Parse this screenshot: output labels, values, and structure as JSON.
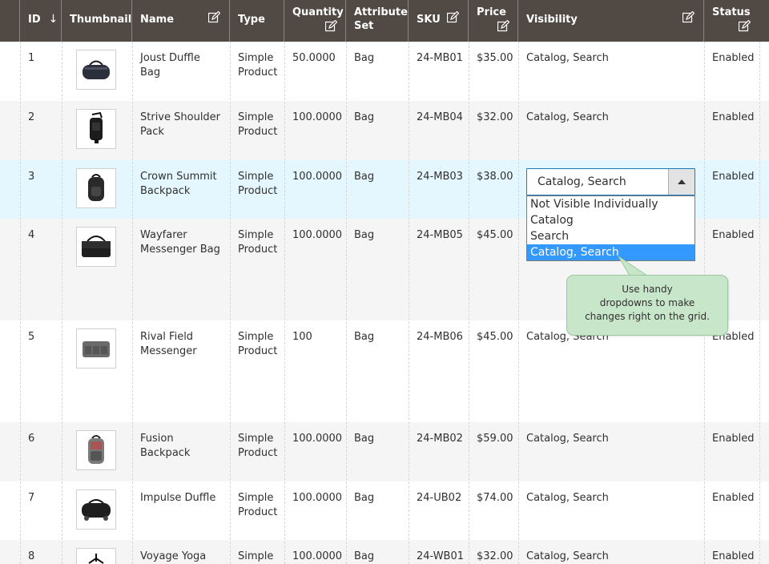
{
  "columns": [
    {
      "label": "ID",
      "sort_icon": "↓"
    },
    {
      "label": "Thumbnail"
    },
    {
      "label": "Name"
    },
    {
      "label": "Type"
    },
    {
      "label": "Quantity"
    },
    {
      "label": "Attribute Set"
    },
    {
      "label": "SKU"
    },
    {
      "label": "Price"
    },
    {
      "label": "Visibility"
    },
    {
      "label": "Status"
    }
  ],
  "rows": [
    {
      "id": "1",
      "name": "Joust Duffle Bag",
      "type": "Simple Product",
      "quantity": "50.0000",
      "attribute_set": "Bag",
      "sku": "24-MB01",
      "price": "$35.00",
      "visibility": "Catalog, Search",
      "status": "Enabled",
      "thumb_icon": "duffle-bag-icon"
    },
    {
      "id": "2",
      "name": "Strive Shoulder Pack",
      "type": "Simple Product",
      "quantity": "100.0000",
      "attribute_set": "Bag",
      "sku": "24-MB04",
      "price": "$32.00",
      "visibility": "Catalog, Search",
      "status": "Enabled",
      "thumb_icon": "shoulder-pack-icon"
    },
    {
      "id": "3",
      "name": "Crown Summit Backpack",
      "type": "Simple Product",
      "quantity": "100.0000",
      "attribute_set": "Bag",
      "sku": "24-MB03",
      "price": "$38.00",
      "visibility": "Catalog, Search",
      "status": "Enabled",
      "thumb_icon": "backpack-icon"
    },
    {
      "id": "4",
      "name": "Wayfarer Messenger Bag",
      "type": "Simple Product",
      "quantity": "100.0000",
      "attribute_set": "Bag",
      "sku": "24-MB05",
      "price": "$45.00",
      "visibility": "",
      "status": "Enabled",
      "thumb_icon": "messenger-bag-icon"
    },
    {
      "id": "5",
      "name": "Rival Field Messenger",
      "type": "Simple Product",
      "quantity": "100",
      "attribute_set": "Bag",
      "sku": "24-MB06",
      "price": "$45.00",
      "visibility": "Catalog, Search",
      "status": "Enabled",
      "thumb_icon": "field-messenger-icon"
    },
    {
      "id": "6",
      "name": "Fusion Backpack",
      "type": "Simple Product",
      "quantity": "100.0000",
      "attribute_set": "Bag",
      "sku": "24-MB02",
      "price": "$59.00",
      "visibility": "Catalog, Search",
      "status": "Enabled",
      "thumb_icon": "fusion-backpack-icon"
    },
    {
      "id": "7",
      "name": "Impulse Duffle",
      "type": "Simple Product",
      "quantity": "100.0000",
      "attribute_set": "Bag",
      "sku": "24-UB02",
      "price": "$74.00",
      "visibility": "Catalog, Search",
      "status": "Enabled",
      "thumb_icon": "rolling-duffle-icon"
    },
    {
      "id": "8",
      "name": "Voyage Yoga",
      "type": "Simple",
      "quantity": "100.0000",
      "attribute_set": "Bag",
      "sku": "24-WB01",
      "price": "$32.00",
      "visibility": "Catalog, Search",
      "status": "Enabled",
      "thumb_icon": "yoga-bag-icon"
    }
  ],
  "visibility_dropdown": {
    "selected": "Catalog, Search",
    "options": [
      "Not Visible Individually",
      "Catalog",
      "Search",
      "Catalog, Search"
    ],
    "highlighted_index": 3
  },
  "tooltip": {
    "lines": [
      "Use handy",
      "dropdowns to make",
      "changes right on the grid."
    ]
  },
  "colors": {
    "header_bg": "#514943",
    "active_row_bg": "#e5f7fe",
    "alt_row_bg": "#f5f5f5",
    "option_highlight": "#3399ff",
    "tooltip_bg": "#c8e6c9",
    "select_border": "#1979c3"
  }
}
